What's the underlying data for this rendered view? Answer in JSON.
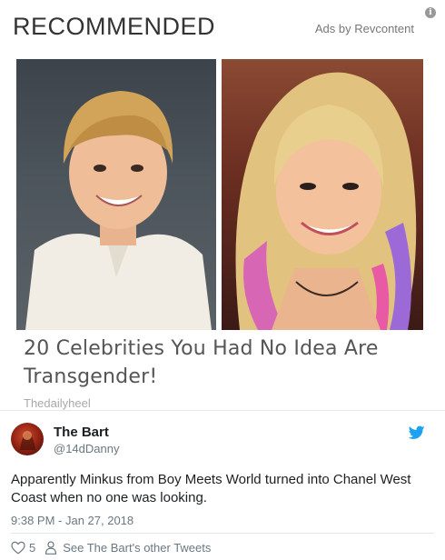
{
  "ad": {
    "header": "RECOMMENDED",
    "by_label": "Ads by Revcontent",
    "info_glyph": "i",
    "headline": "20 Celebrities You Had No Idea Are Transgender!",
    "source": "Thedailyheel"
  },
  "tweet": {
    "name": "The Bart",
    "handle": "@14dDanny",
    "text": "Apparently Minkus from Boy Meets World turned into Chanel West Coast when no one was looking.",
    "timestamp": "9:38 PM - Jan 27, 2018",
    "like_count": "5",
    "profile_link": "See The Bart's other Tweets",
    "brand_color": "#1da1f2"
  },
  "icons": {
    "info": "info-icon",
    "bird": "twitter-bird-icon",
    "heart": "heart-icon",
    "person": "person-icon"
  }
}
